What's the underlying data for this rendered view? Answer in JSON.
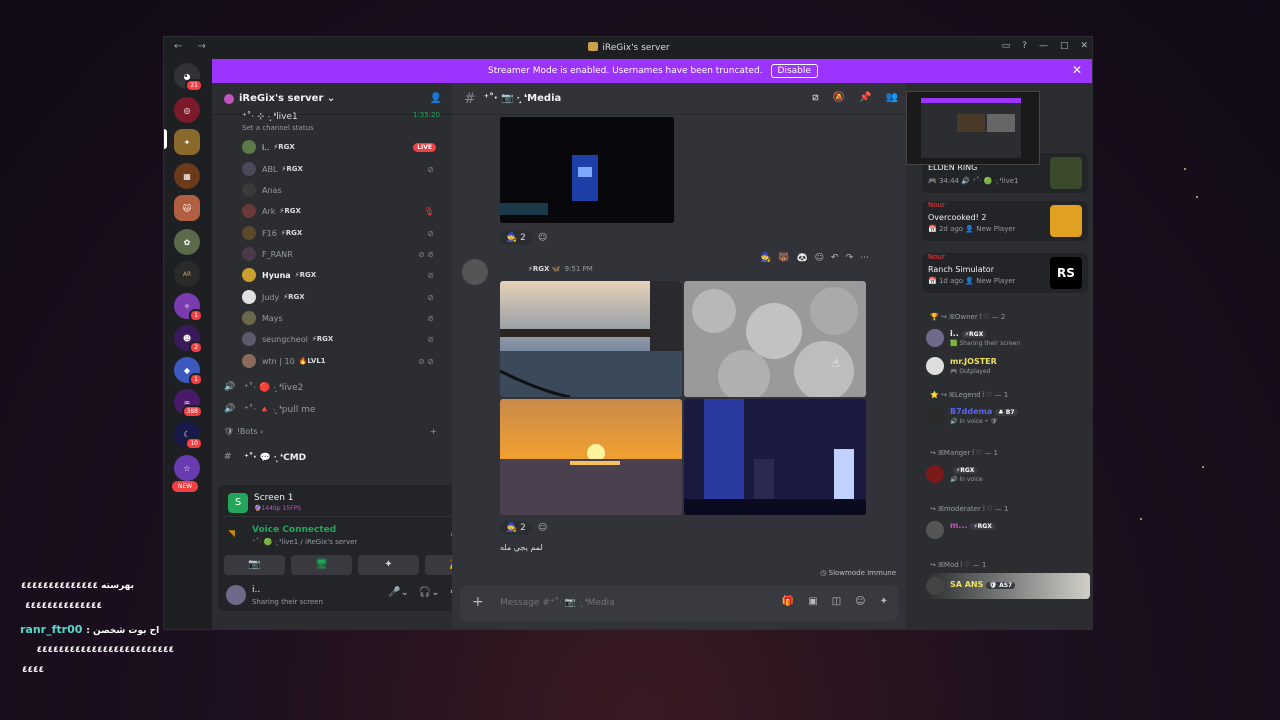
{
  "window": {
    "title": "iReGix's server",
    "nav_arrows": "← →",
    "buttons": [
      "▭",
      "?",
      "—",
      "□",
      "✕"
    ]
  },
  "banner": {
    "text": "Streamer Mode is enabled. Usernames have been truncated.",
    "button": "Disable",
    "close": "✕"
  },
  "guilds": {
    "home_badge": "21",
    "badges": [
      "1",
      "2",
      "1",
      "388",
      "10"
    ],
    "new_label": "NEW"
  },
  "server": {
    "name": "iReGix's server",
    "voice_top": "⁺˚‧ ⊹ ·̩͙ ❛live1",
    "channel_status": "Set a channel status",
    "timer": "1:35:20"
  },
  "members_voice": [
    {
      "name": "i..",
      "tag": "⚡RGX",
      "live": "LIVE"
    },
    {
      "name": "ABL",
      "tag": "⚡RGX"
    },
    {
      "name": "Anas",
      "tag": ""
    },
    {
      "name": "Ark",
      "tag": "⚡RGX"
    },
    {
      "name": "F16",
      "tag": "⚡RGX"
    },
    {
      "name": "F_RANR",
      "tag": ""
    },
    {
      "name": "Hyuna",
      "tag": "⚡RGX"
    },
    {
      "name": "Judy",
      "tag": "⚡RGX"
    },
    {
      "name": "Mays",
      "tag": ""
    },
    {
      "name": "seungcheol",
      "tag": "⚡RGX"
    },
    {
      "name": "wtn | 10",
      "tag": "🔥LVL1"
    }
  ],
  "channels": {
    "live2": "⁺˚‧ 🔴 ·̩͙ ❛live2",
    "pullme": "⁺˚‧ 🔺 ·̩͙ ❛pull me",
    "bots_cat": "!Bots",
    "cmd": "⁺˚‧ 💬 ·̩͙ ❛CMD"
  },
  "screen_panel": {
    "title": "Screen 1",
    "quality": "🔮1440p 15FPS",
    "voice_connected": "Voice Connected",
    "voice_sub": "⁺˚‧ 🟢 ·̩͙ ❛live1 / iReGix's server",
    "buttons": [
      "📷",
      "🖥",
      "✦",
      "🎉"
    ]
  },
  "user": {
    "name": "i..",
    "status": "Sharing their screen"
  },
  "chat": {
    "channel": "⁺˚‧ 📷 ·̩͙ ❛Media",
    "react_count_1": "2",
    "react_count_2": "2",
    "msg_tag": "⚡RGX 🦋",
    "msg_time": "9:51 PM",
    "small_msg": "لمم يجي مله",
    "slowmode": "Slowmode Immune",
    "placeholder": "Message #⁺˚‧ 📷 ·̩͙ ❛Media"
  },
  "activity": [
    {
      "prefix": "",
      "name": "ELDEN RING",
      "sub": "🎮 34:44 🔊 ⁺˚‧ 🟢 ·̩͙ ❛live1"
    },
    {
      "prefix": "Nour",
      "name": "Overcooked! 2",
      "sub": "📅 2d ago 👤 New Player"
    },
    {
      "prefix": "Nour",
      "name": "Ranch Simulator",
      "sub": "📅 1d ago 👤 New Player"
    }
  ],
  "roles": {
    "owner": "🏆 ↪ ꕤOwner꒱♡ — 2",
    "legend": "⭐ ↪ ꕤLegend꒱♡ — 1",
    "manger": "↪ ꕤManger꒱♡ — 1",
    "moderater": "↪ ꕤmoderater꒱♡ — 1",
    "mod": "↪ ꕤMod꒱♡ — 1"
  },
  "member_list": [
    {
      "name": "i..",
      "chip": "⚡RGX",
      "sub": "🟩 Sharing their screen",
      "color": "#f2f3f5"
    },
    {
      "name": "mr.JOSTER",
      "chip": "",
      "sub": "🎮 Outplayed",
      "color": "#f0e060"
    },
    {
      "name": "B7ddema",
      "chip": "♣ B7",
      "sub": "🔊 In voice • 🛡",
      "color": "#5865f2"
    },
    {
      "name": "",
      "chip": "⚡RGX",
      "sub": "🔊 In voice",
      "color": "#f23f43"
    },
    {
      "name": "m...",
      "chip": "⚡RGX",
      "sub": "",
      "color": "#c154c1"
    },
    {
      "name": "SA ANS",
      "chip": "🛡 AS7",
      "sub": "",
      "color": "#f0e060"
    }
  ],
  "overlay": {
    "line1": "بهرسته ٤٤٤٤٤٤٤٤٤٤٤٤٤٤",
    "line2": "٤٤٤٤٤٤٤٤٤٤٤٤٤٤",
    "chat_name": "ranr_ftr00",
    "chat_text": ": اح بوت شخصن",
    "line4": "٤٤٤٤٤٤٤٤٤٤٤٤٤٤٤٤٤٤٤٤٤٤٤٤٤",
    "line5": "٤٤٤٤"
  },
  "colors": {
    "accent": "#9c33ff",
    "green": "#23a55a",
    "red": "#f23f43"
  }
}
